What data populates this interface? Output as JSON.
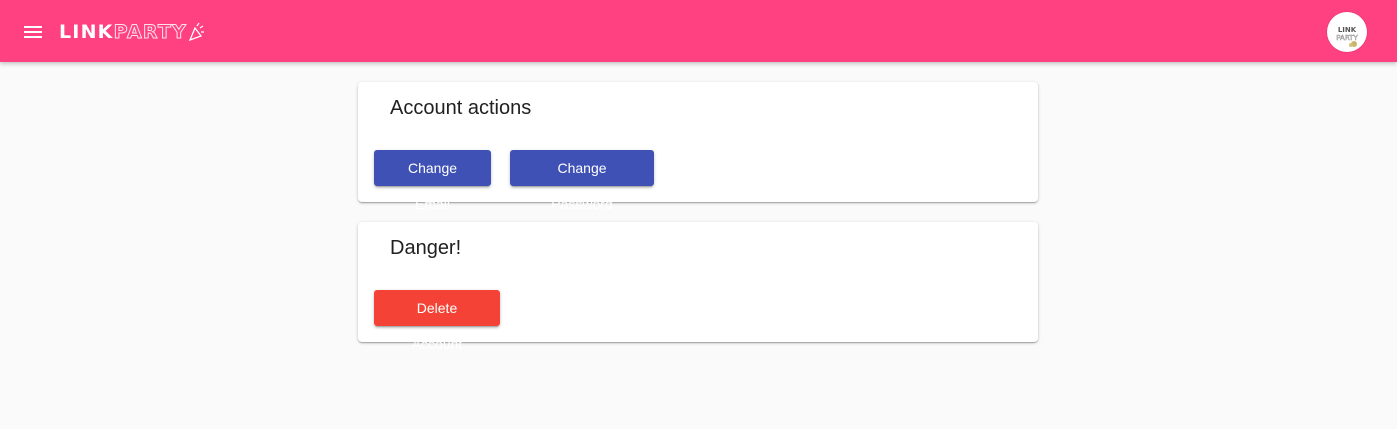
{
  "colors": {
    "toolbar": "#ff4081",
    "primary": "#3f51b5",
    "warn": "#f44336",
    "background": "#fafafa"
  },
  "header": {
    "menu_icon": "hamburger-menu-icon",
    "logo": {
      "part1": "LINK",
      "part2": "PARTY",
      "icon": "party-popper-icon"
    },
    "avatar": {
      "icon": "linkparty-logo-avatar",
      "text_line1": "LINK",
      "text_line2": "PARTY"
    }
  },
  "account_card": {
    "title": "Account actions",
    "change_email_label": "Change Email",
    "change_password_label": "Change Password"
  },
  "danger_card": {
    "title": "Danger!",
    "delete_account_label": "Delete Account"
  }
}
